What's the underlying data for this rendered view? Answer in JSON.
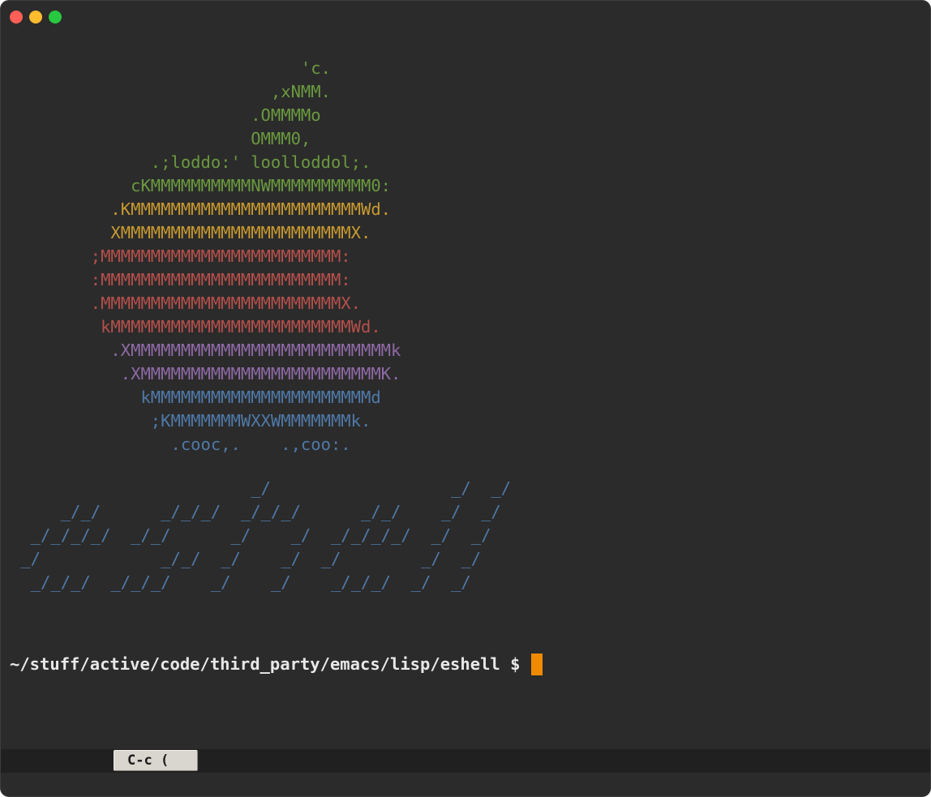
{
  "window": {
    "buttons": [
      "close",
      "minimize",
      "maximize"
    ]
  },
  "colors": {
    "background": "#2b2b2b",
    "green": "#6a9a3f",
    "yellow": "#c89a30",
    "red": "#b5504b",
    "purple": "#8f6aa6",
    "blue": "#4f79a8",
    "cursor": "#f08a00"
  },
  "apple_art": [
    {
      "text": "                             'c.",
      "color": "green"
    },
    {
      "text": "                          ,xNMM.",
      "color": "green"
    },
    {
      "text": "                        .OMMMMo",
      "color": "green"
    },
    {
      "text": "                        OMMM0,",
      "color": "green"
    },
    {
      "text": "              .;loddo:' loolloddol;.",
      "color": "green"
    },
    {
      "text": "            cKMMMMMMMMMMNWMMMMMMMMMM0:",
      "color": "green"
    },
    {
      "text": "          .KMMMMMMMMMMMMMMMMMMMMMMMWd.",
      "color": "yellow"
    },
    {
      "text": "          XMMMMMMMMMMMMMMMMMMMMMMMX.",
      "color": "yellow"
    },
    {
      "text": "        ;MMMMMMMMMMMMMMMMMMMMMMMM:",
      "color": "red"
    },
    {
      "text": "        :MMMMMMMMMMMMMMMMMMMMMMMM:",
      "color": "red"
    },
    {
      "text": "        .MMMMMMMMMMMMMMMMMMMMMMMMX.",
      "color": "red"
    },
    {
      "text": "         kMMMMMMMMMMMMMMMMMMMMMMMMWd.",
      "color": "red"
    },
    {
      "text": "          .XMMMMMMMMMMMMMMMMMMMMMMMMMMk",
      "color": "purple"
    },
    {
      "text": "           .XMMMMMMMMMMMMMMMMMMMMMMMMK.",
      "color": "purple"
    },
    {
      "text": "             kMMMMMMMMMMMMMMMMMMMMMMd",
      "color": "blue"
    },
    {
      "text": "              ;KMMMMMMMWXXWMMMMMMMk.",
      "color": "blue"
    },
    {
      "text": "                .cooc,.    .,coo:.",
      "color": "blue"
    }
  ],
  "eshell_logo": [
    "                        _/                  _/  _/",
    "     _/_/      _/_/_/  _/_/_/      _/_/    _/  _/",
    "  _/_/_/_/  _/_/      _/    _/  _/_/_/_/  _/  _/",
    " _/            _/_/  _/    _/  _/        _/  _/",
    "  _/_/_/  _/_/_/    _/    _/    _/_/_/  _/  _/"
  ],
  "prompt": {
    "text": "~/stuff/active/code/third_party/emacs/lisp/eshell $"
  },
  "modeline": {
    "key_hint": "C-c ("
  }
}
